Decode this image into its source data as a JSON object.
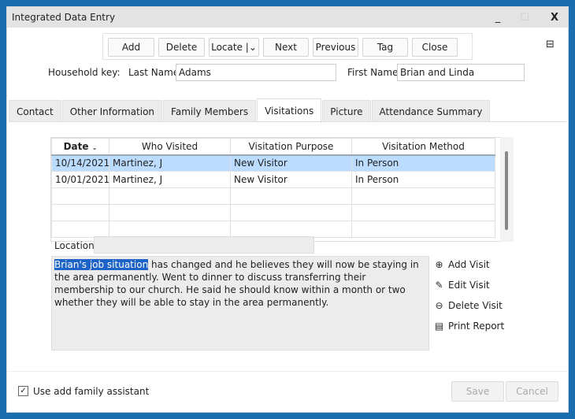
{
  "window": {
    "title": "Integrated Data Entry",
    "minimize": "_",
    "close": "X"
  },
  "toolbar": {
    "add": "Add",
    "delete": "Delete",
    "locate": "Locate",
    "next": "Next",
    "previous": "Previous",
    "tag": "Tag",
    "close": "Close"
  },
  "header": {
    "household_key_label": "Household key:",
    "last_name_label": "Last Name:",
    "last_name": "Adams",
    "first_name_label": "First Name:",
    "first_name": "Brian and Linda"
  },
  "tabs": [
    "Contact",
    "Other Information",
    "Family Members",
    "Visitations",
    "Picture",
    "Attendance Summary"
  ],
  "active_tab": "Visitations",
  "grid": {
    "columns": [
      "Date",
      "Who Visited",
      "Visitation Purpose",
      "Visitation Method"
    ],
    "rows": [
      [
        "10/14/2021",
        "Martinez, J",
        "New Visitor",
        "In Person"
      ],
      [
        "10/01/2021",
        "Martinez, J",
        "New Visitor",
        "In Person"
      ]
    ],
    "selected_row": 0
  },
  "location": {
    "label": "Location:",
    "value": ""
  },
  "notes": {
    "selected": "Brian's job situation",
    "rest": " has changed and he believes they will now be staying in the area permanently.  Went to dinner to discuss transferring their membership to our church. He said he should know within a month or two whether they will be able to stay in the area permanently."
  },
  "actions": {
    "add_visit": "Add Visit",
    "edit_visit": "Edit Visit",
    "delete_visit": "Delete Visit",
    "print_report": "Print Report"
  },
  "footer": {
    "assistant_label": "Use add family assistant",
    "assistant_checked": true,
    "save": "Save",
    "cancel": "Cancel"
  }
}
